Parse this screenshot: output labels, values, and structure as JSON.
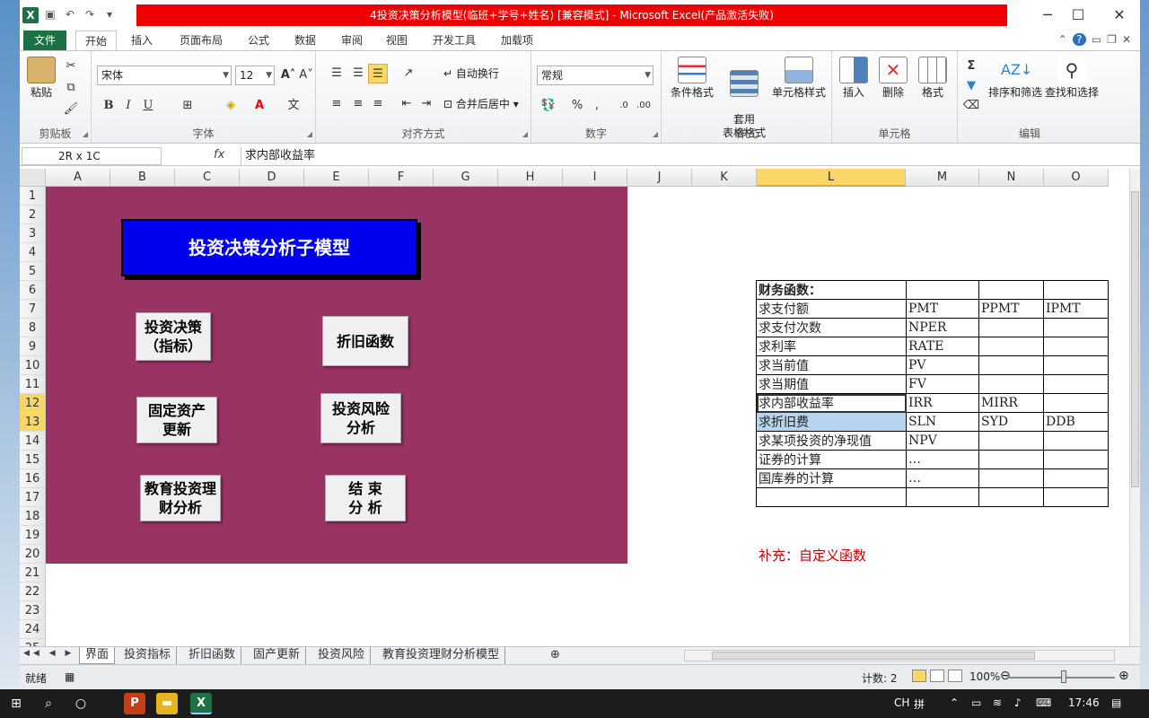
{
  "window": {
    "title": "4投资决策分析模型(临班+学号+姓名)    [兼容模式]  -  Microsoft Excel(产品激活失败)"
  },
  "ribbon_tabs": [
    "文件",
    "开始",
    "插入",
    "页面布局",
    "公式",
    "数据",
    "审阅",
    "视图",
    "开发工具",
    "加载项"
  ],
  "ribbon": {
    "clipboard": {
      "paste": "粘贴",
      "label": "剪贴板"
    },
    "font": {
      "name": "宋体",
      "size": "12",
      "label": "字体",
      "bold": "B",
      "italic": "I",
      "underline": "U"
    },
    "alignment": {
      "wrap": "自动换行",
      "merge": "合并后居中",
      "label": "对齐方式"
    },
    "number": {
      "format": "常规",
      "label": "数字"
    },
    "styles": {
      "conditional": "条件格式",
      "table_fmt": "套用\n表格格式",
      "cell_styles": "单元格样式",
      "label": "样式"
    },
    "cells": {
      "insert": "插入",
      "delete": "删除",
      "format": "格式",
      "label": "单元格"
    },
    "editing": {
      "sort": "排序和筛选",
      "find": "查找和选择",
      "label": "编辑"
    }
  },
  "formula_bar": {
    "name_box": "2R x 1C",
    "fx": "fx",
    "formula": "求内部收益率"
  },
  "columns": [
    "A",
    "B",
    "C",
    "D",
    "E",
    "F",
    "G",
    "H",
    "I",
    "J",
    "K",
    "L",
    "M",
    "N",
    "O"
  ],
  "rows": [
    "1",
    "2",
    "3",
    "4",
    "5",
    "6",
    "7",
    "8",
    "9",
    "10",
    "11",
    "12",
    "13",
    "14",
    "15",
    "16",
    "17",
    "18",
    "19",
    "20",
    "21",
    "22",
    "23",
    "24",
    "25"
  ],
  "panel": {
    "banner": "投资决策分析子模型",
    "buttons": [
      "投资决策\n（指标）",
      "折旧函数",
      "固定资产\n更新",
      "投资风险\n分析",
      "教育投资理\n财分析",
      "结  束\n分  析"
    ]
  },
  "finance_table": {
    "rows": [
      [
        "财务函数：",
        "",
        "",
        ""
      ],
      [
        "求支付额",
        "PMT",
        "PPMT",
        "IPMT"
      ],
      [
        "求支付次数",
        "NPER",
        "",
        ""
      ],
      [
        "求利率",
        "RATE",
        "",
        ""
      ],
      [
        "求当前值",
        "PV",
        "",
        ""
      ],
      [
        "求当期值",
        "FV",
        "",
        ""
      ],
      [
        "求内部收益率",
        "IRR",
        "MIRR",
        ""
      ],
      [
        "求折旧费",
        "SLN",
        "SYD",
        "DDB"
      ],
      [
        "求某项投资的净现值",
        "NPV",
        "",
        ""
      ],
      [
        "证券的计算",
        "…",
        "",
        ""
      ],
      [
        "国库券的计算",
        "…",
        "",
        ""
      ],
      [
        "",
        "",
        "",
        ""
      ]
    ]
  },
  "supplement": "补充：自定义函数",
  "sheet_tabs": [
    "界面",
    "投资指标",
    "折旧函数",
    "固产更新",
    "投资风险",
    "教育投资理财分析模型"
  ],
  "status": {
    "ready": "就绪",
    "count": "计数: 2",
    "zoom": "100%"
  },
  "taskbar": {
    "ime": "CH",
    "time": "17:46"
  }
}
